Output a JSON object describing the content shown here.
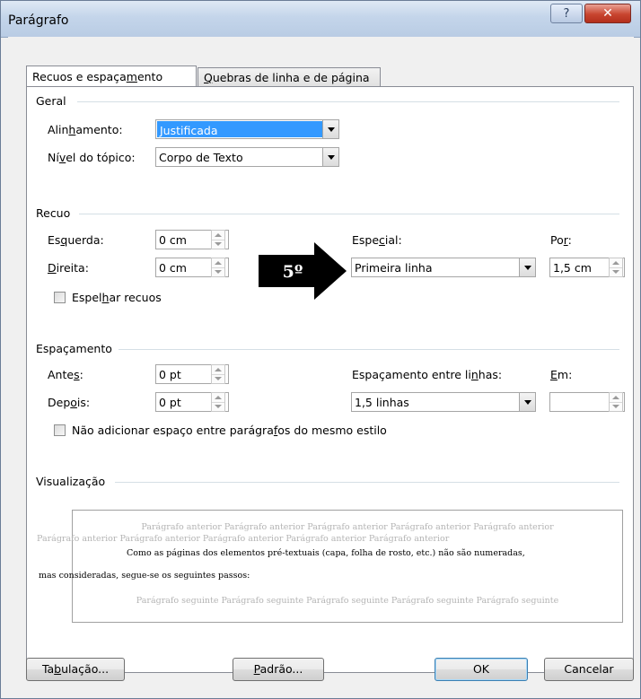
{
  "window": {
    "title": "Parágrafo",
    "help_label": "?",
    "close_label": "✕"
  },
  "tabs": [
    {
      "pre": "Recuos e espaça",
      "u": "m",
      "post": "ento"
    },
    {
      "pre": "",
      "u": "Q",
      "post": "uebras de linha e de página"
    }
  ],
  "geral": {
    "header": "Geral",
    "alignment": {
      "pre": "Alin",
      "u": "h",
      "post": "amento:",
      "value": "Justificada"
    },
    "outline": {
      "pre": "Ní",
      "u": "v",
      "post": "el do tópico:",
      "value": "Corpo de Texto"
    }
  },
  "recuo": {
    "header": "Recuo",
    "esquerda": {
      "pre": "Es",
      "u": "q",
      "post": "uerda:",
      "value": "0 cm"
    },
    "direita": {
      "pre": "",
      "u": "D",
      "post": "ireita:",
      "value": "0 cm"
    },
    "especial": {
      "pre": "Espe",
      "u": "c",
      "post": "ial:",
      "value": "Primeira linha"
    },
    "por": {
      "pre": "Po",
      "u": "r",
      "post": ":",
      "value": "1,5 cm"
    },
    "espelhar": {
      "pre": "Espel",
      "u": "h",
      "post": "ar recuos"
    }
  },
  "annotation": {
    "text": "5º"
  },
  "espacamento": {
    "header": "Espaçamento",
    "antes": {
      "pre": "Ante",
      "u": "s",
      "post": ":",
      "value": "0 pt"
    },
    "depois": {
      "pre": "Dep",
      "u": "o",
      "post": "is:",
      "value": "0 pt"
    },
    "entre_linhas": {
      "pre": "Espaçamento entre li",
      "u": "n",
      "post": "has:",
      "value": "1,5 linhas"
    },
    "em": {
      "pre": "",
      "u": "E",
      "post": "m:",
      "value": ""
    },
    "nao_adicionar": {
      "pre": "Não adicionar espaço entre parágra",
      "u": "f",
      "post": "os do mesmo estilo"
    }
  },
  "visualizacao": {
    "header": "Visualização",
    "lines": [
      "Parágrafo anterior Parágrafo anterior Parágrafo anterior Parágrafo anterior Parágrafo anterior",
      "Parágrafo anterior Parágrafo anterior Parágrafo anterior Parágrafo anterior Parágrafo anterior",
      "Como as páginas dos elementos pré-textuais (capa, folha de rosto, etc.) não são numeradas,",
      "mas consideradas, segue-se os seguintes passos:",
      "Parágrafo seguinte Parágrafo seguinte Parágrafo seguinte Parágrafo seguinte Parágrafo seguinte"
    ]
  },
  "buttons": {
    "tabulacao": {
      "pre": "Ta",
      "u": "b",
      "post": "ulação..."
    },
    "padrao": {
      "pre": "",
      "u": "P",
      "post": "adrão..."
    },
    "ok": "OK",
    "cancelar": "Cancelar"
  }
}
